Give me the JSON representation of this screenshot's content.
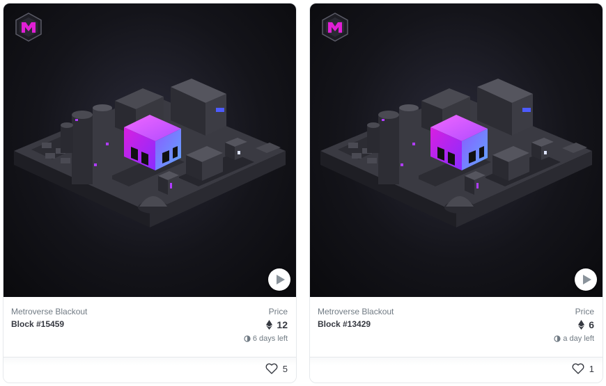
{
  "cards": [
    {
      "collection": "Metroverse Blackout",
      "name": "Block #15459",
      "price_label": "Price",
      "price": "12",
      "time_left": "6 days left",
      "likes": "5"
    },
    {
      "collection": "Metroverse Blackout",
      "name": "Block #13429",
      "price_label": "Price",
      "price": "6",
      "time_left": "a day left",
      "likes": "1"
    }
  ],
  "icons": {
    "logo": "metroverse-logo-icon",
    "play": "play-icon",
    "currency": "ethereum-icon",
    "clock": "clock-icon",
    "like": "heart-icon"
  },
  "colors": {
    "accent_magenta": "#e11fd6",
    "accent_purple": "#7a3cff",
    "text_primary": "#353840",
    "text_secondary": "#707a83"
  }
}
